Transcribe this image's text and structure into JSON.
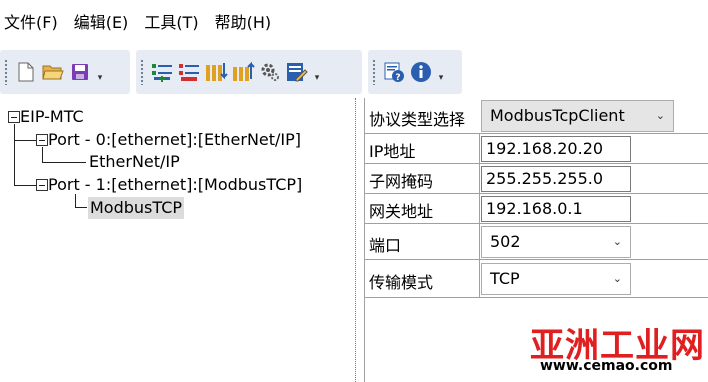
{
  "menu": {
    "items": [
      "文件(F)",
      "编辑(E)",
      "工具(T)",
      "帮助(H)"
    ]
  },
  "toolbar": {
    "group1_icons": [
      "new-file-icon",
      "open-folder-icon",
      "save-icon"
    ],
    "group2_icons": [
      "add-port-icon",
      "remove-port-icon",
      "import-icon",
      "export-icon",
      "settings-icon",
      "edit-icon"
    ],
    "group3_icons": [
      "help-icon",
      "info-icon"
    ]
  },
  "tree": {
    "root": "EIP-MTC",
    "port0": "Port - 0:[ethernet]:[EtherNet/IP]",
    "port0_child": "EtherNet/IP",
    "port1": "Port - 1:[ethernet]:[ModbusTCP]",
    "port1_child": "ModbusTCP"
  },
  "properties": {
    "protocol_label": "协议类型选择",
    "protocol_value": "ModbusTcpClient",
    "ip_label": "IP地址",
    "ip_value": "192.168.20.20",
    "mask_label": "子网掩码",
    "mask_value": "255.255.255.0",
    "gateway_label": "网关地址",
    "gateway_value": "192.168.0.1",
    "port_label": "端口",
    "port_value": "502",
    "mode_label": "传输模式",
    "mode_value": "TCP"
  },
  "watermark": {
    "title": "亚洲工业网",
    "url": "www.cemao.com"
  },
  "colors": {
    "toolbar_bg": "#e7ecf4",
    "watermark_red": "#e02020",
    "selected_bg": "#dcdcdc"
  }
}
